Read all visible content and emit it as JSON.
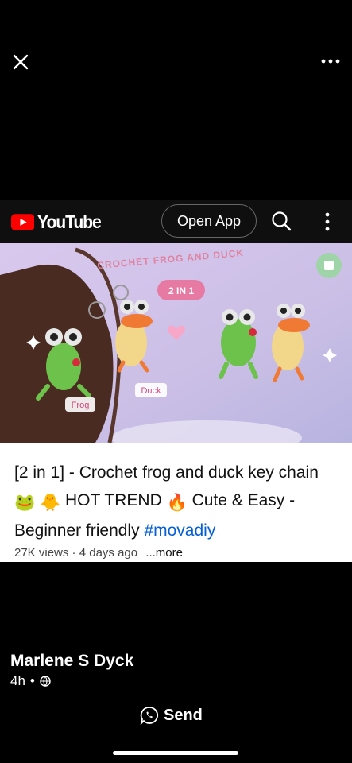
{
  "header": {
    "youtube_logo_text": "YouTube",
    "open_app_label": "Open App"
  },
  "thumbnail": {
    "headline": "CROCHET FROG AND DUCK",
    "badge": "2 IN 1",
    "label_frog": "Frog",
    "label_duck": "Duck"
  },
  "video": {
    "title_part1": "[2 in 1] - Crochet frog and duck key chain",
    "title_part2": "HOT TREND",
    "title_part3": "Cute & Easy - Beginner friendly",
    "hashtag": "#movadiy",
    "views": "27K views",
    "age": "4 days ago",
    "more": "...more",
    "emoji_1": "🐸",
    "emoji_2": "🐥",
    "emoji_3": "🔥"
  },
  "post": {
    "author": "Marlene S Dyck",
    "time": "4h",
    "separator": "•",
    "send_label": "Send"
  },
  "colors": {
    "youtube_red": "#ff0000",
    "link_blue": "#065fd4"
  }
}
